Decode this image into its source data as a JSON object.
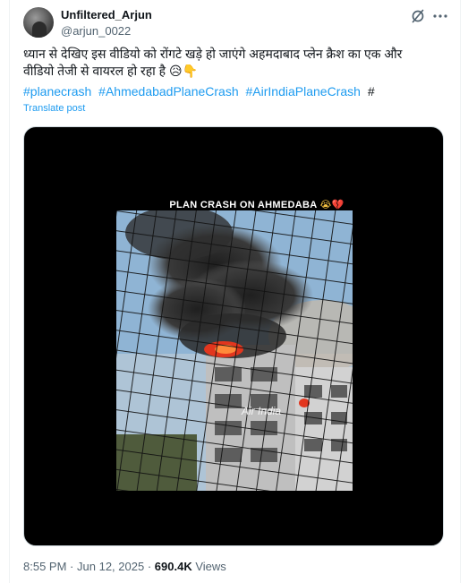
{
  "author": {
    "name": "Unfiltered_Arjun",
    "handle": "@arjun_0022"
  },
  "tweet": {
    "text": "ध्यान से देखिए इस वीडियो को रोंगटे खड़े हो जाएंगे अहमदाबाद प्लेन क्रैश का एक और वीडियो तेजी से वायरल हो रहा है",
    "emojis": "😥👇",
    "hashtags": [
      "#planecrash",
      "#AhmedabadPlaneCrash",
      "#AirIndiaPlaneCrash"
    ],
    "trailing_hash": "#",
    "translate_label": "Translate post"
  },
  "media": {
    "caption": "PLAN CRASH ON AHMEDABA",
    "caption_emoji_1": "😭",
    "caption_emoji_2": "💔",
    "overlay_text": "Air India"
  },
  "meta": {
    "time": "8:55 PM",
    "separator": "·",
    "date": "Jun 12, 2025",
    "views_count": "690.4K",
    "views_label": "Views"
  },
  "icons": {
    "grok": "grok-icon",
    "more": "more-icon"
  },
  "colors": {
    "link": "#1d9bf0",
    "secondary_text": "#536471",
    "primary_text": "#0f1419"
  }
}
